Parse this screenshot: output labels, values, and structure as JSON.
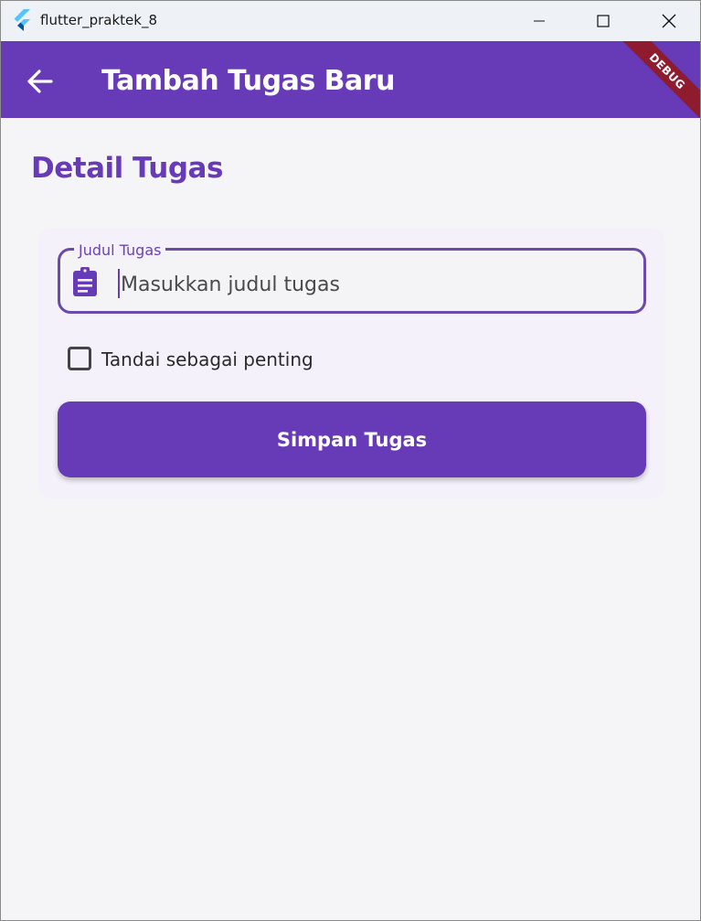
{
  "window": {
    "title": "flutter_praktek_8",
    "icon": "flutter-logo-icon"
  },
  "appbar": {
    "title": "Tambah Tugas Baru",
    "back_icon": "arrow-back-icon",
    "debug_banner": "DEBUG"
  },
  "form": {
    "section_title": "Detail Tugas",
    "title_field": {
      "label": "Judul Tugas",
      "placeholder": "Masukkan judul tugas",
      "value": "",
      "icon": "clipboard-icon"
    },
    "important_checkbox": {
      "label": "Tandai sebagai penting",
      "checked": false
    },
    "save_button_label": "Simpan Tugas"
  },
  "colors": {
    "primary": "#673ab7",
    "background": "#f5f5f8",
    "debug": "#8e1b2e"
  }
}
